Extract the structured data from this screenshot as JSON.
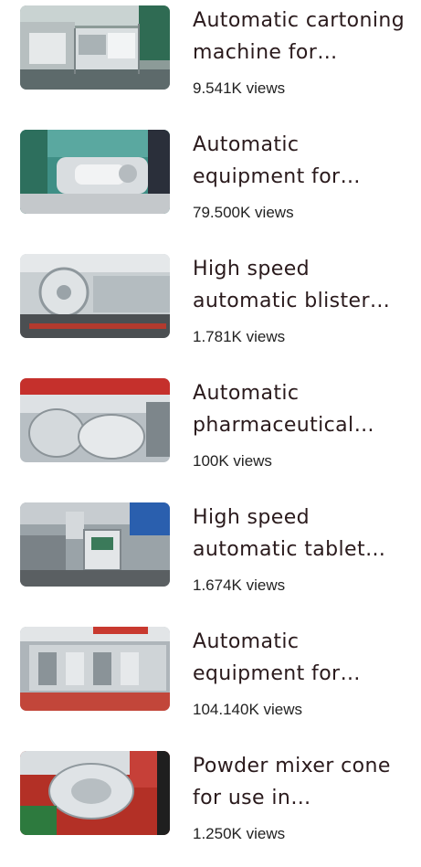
{
  "videos": [
    {
      "title": "Automatic cartoning machine for pharmaceutical packaging",
      "views": "9.541K views"
    },
    {
      "title": "Automatic equipment for pharmaceutical production",
      "views": "79.500K views"
    },
    {
      "title": "High speed automatic blister packing machine",
      "views": "1.781K views"
    },
    {
      "title": "Automatic pharmaceutical mixing equipment",
      "views": "100K views"
    },
    {
      "title": "High speed automatic tablet press machine",
      "views": "1.674K views"
    },
    {
      "title": "Automatic equipment for ampoule filling",
      "views": "104.140K views"
    },
    {
      "title": "Powder mixer cone for use in pharmaceutical industry",
      "views": "1.250K views"
    }
  ]
}
